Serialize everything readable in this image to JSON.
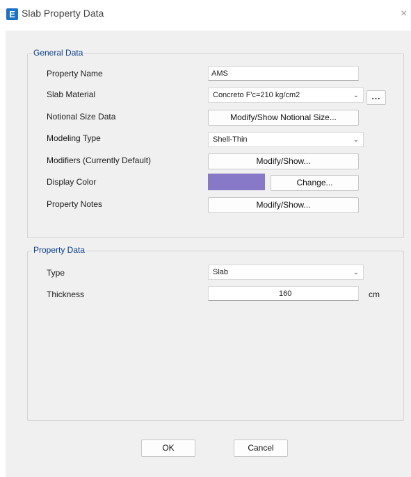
{
  "window": {
    "title": "Slab Property Data",
    "app_icon_letter": "E",
    "close_glyph": "×"
  },
  "general": {
    "group_label": "General Data",
    "property_name_label": "Property Name",
    "property_name_value": "AMS",
    "slab_material_label": "Slab Material",
    "slab_material_value": "Concreto F'c=210 kg/cm2",
    "slab_material_browse": "...",
    "notional_size_label": "Notional Size Data",
    "notional_size_button": "Modify/Show Notional Size...",
    "modeling_type_label": "Modeling Type",
    "modeling_type_value": "Shell-Thin",
    "modifiers_label": "Modifiers (Currently Default)",
    "modifiers_button": "Modify/Show...",
    "display_color_label": "Display Color",
    "display_color_value": "#8778c8",
    "display_color_button": "Change...",
    "property_notes_label": "Property Notes",
    "property_notes_button": "Modify/Show..."
  },
  "property": {
    "group_label": "Property Data",
    "type_label": "Type",
    "type_value": "Slab",
    "thickness_label": "Thickness",
    "thickness_value": "160",
    "thickness_unit": "cm"
  },
  "footer": {
    "ok_label": "OK",
    "cancel_label": "Cancel"
  },
  "icons": {
    "dropdown": "chevron-down-icon"
  }
}
